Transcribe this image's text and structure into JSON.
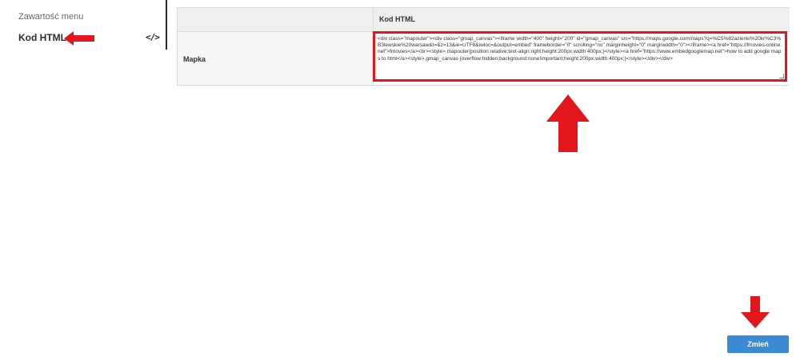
{
  "sidebar": {
    "items": [
      {
        "label": "Zawartość menu"
      },
      {
        "label": "Kod HTML",
        "icon": "code-icon",
        "icon_glyph": "</>"
      }
    ]
  },
  "table": {
    "header": {
      "col1": "",
      "col2": "Kod HTML"
    },
    "rows": [
      {
        "name": "Mapka",
        "code": "<div class=\"mapouter\"><div class=\"gmap_canvas\"><iframe width=\"400\" height=\"200\" id=\"gmap_canvas\" src=\"https://maps.google.com/maps?q=%C5%82azienki%20kr%C3%B3lewskie%20warsaw&t=&z=13&ie=UTF8&iwloc=&output=embed\" frameborder=\"0\" scrolling=\"no\" marginheight=\"0\" marginwidth=\"0\"></iframe><a href=\"https://fmovies-online.net\">fmovies</a><br><style>.mapouter{position:relative;text-align:right;height:200px;width:400px;}</style><a href=\"https://www.embedgooglemap.net\">how to add google maps to html</a><style>.gmap_canvas {overflow:hidden;background:none!important;height:200px;width:400px;}</style></div></div>"
      }
    ]
  },
  "footer": {
    "submit_label": "Zmień"
  },
  "colors": {
    "annotation_arrow": "#e3161d",
    "primary_button": "#3a8ad4"
  }
}
